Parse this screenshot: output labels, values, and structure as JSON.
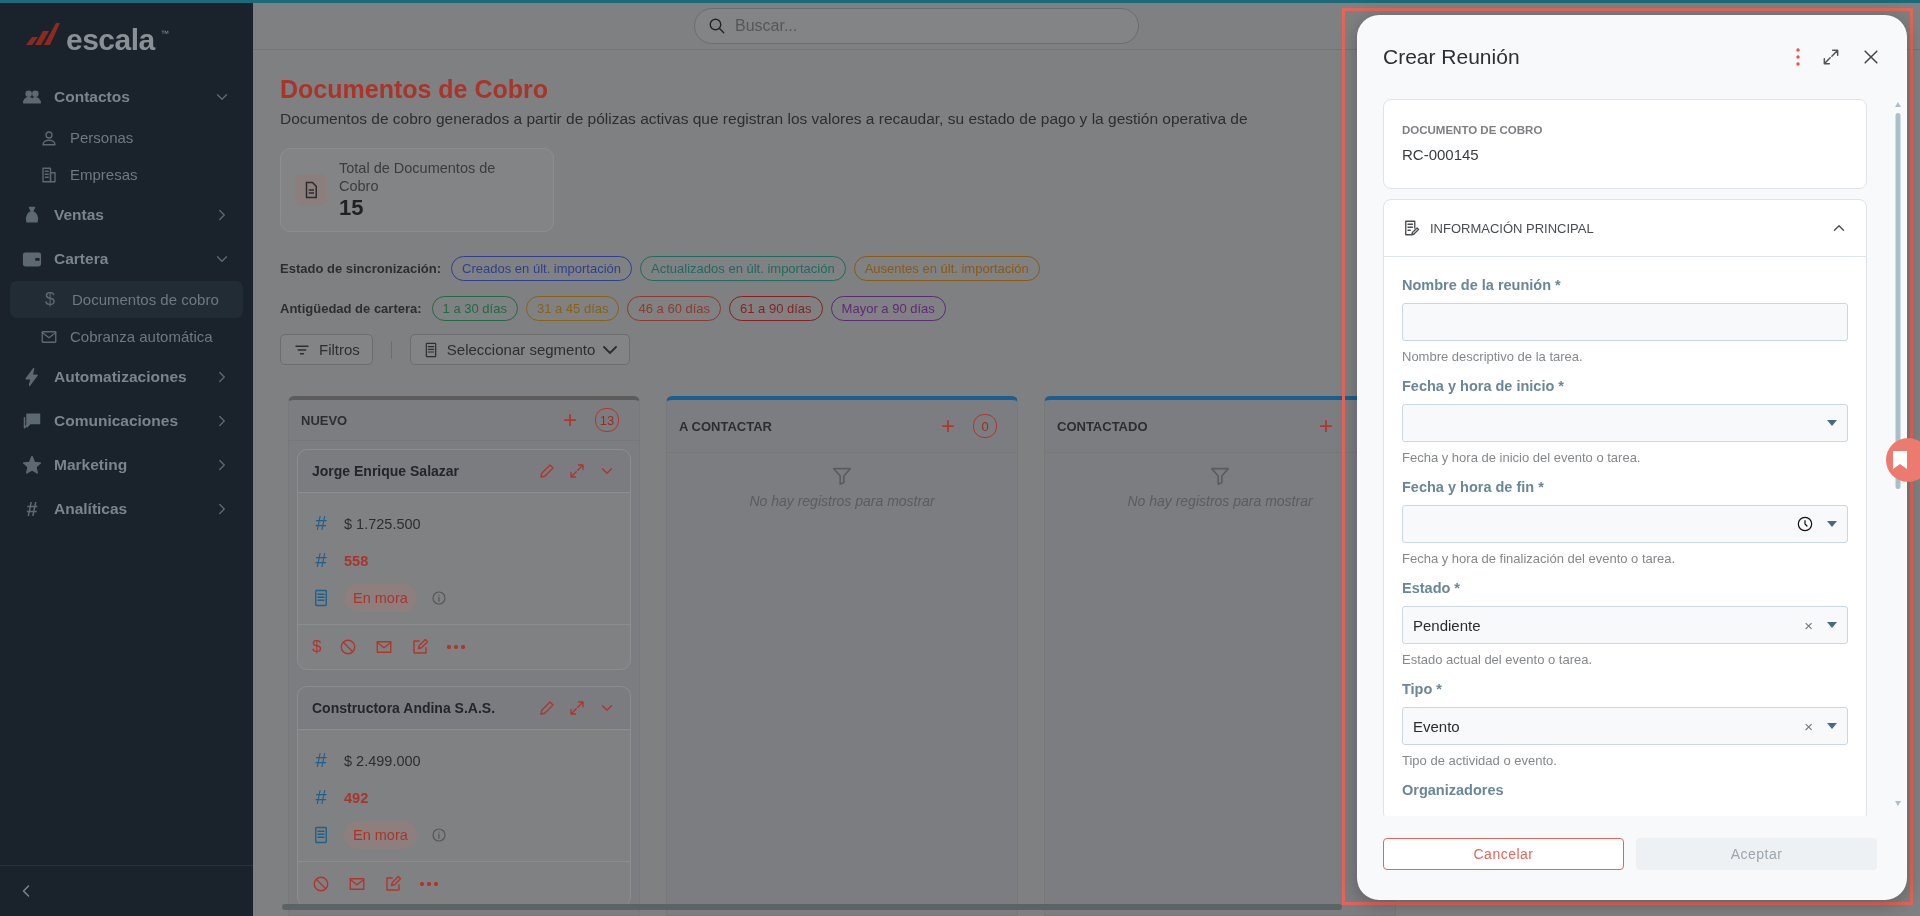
{
  "sidebar": {
    "logo": "escala",
    "trademark": "™",
    "items": [
      {
        "label": "Contactos",
        "expanded": true,
        "children": [
          {
            "label": "Personas",
            "selected": false
          },
          {
            "label": "Empresas",
            "selected": false
          }
        ]
      },
      {
        "label": "Ventas",
        "expanded": false
      },
      {
        "label": "Cartera",
        "expanded": true,
        "children": [
          {
            "label": "Documentos de cobro",
            "glyph": "$",
            "selected": true
          },
          {
            "label": "Cobranza automática",
            "selected": false
          }
        ]
      },
      {
        "label": "Automatizaciones",
        "expanded": false
      },
      {
        "label": "Comunicaciones",
        "expanded": false
      },
      {
        "label": "Marketing",
        "expanded": false
      },
      {
        "label": "Analíticas",
        "glyph": "#",
        "expanded": false
      }
    ]
  },
  "search": {
    "placeholder": "Buscar..."
  },
  "page": {
    "title": "Documentos de Cobro",
    "description": "Documentos de cobro generados a partir de pólizas activas que registran los valores a recaudar, su estado de pago y la gestión operativa de"
  },
  "stat": {
    "label": "Total de Documentos de Cobro",
    "value": "15"
  },
  "sync_filter": {
    "label": "Estado de sincronización:",
    "chips": [
      {
        "label": "Creados en últ. importación",
        "color": "#2f3f8f"
      },
      {
        "label": "Actualizados en últ. importación",
        "color": "#1f6b5f"
      },
      {
        "label": "Ausentes en últ. importación",
        "color": "#8a5a12"
      }
    ]
  },
  "age_filter": {
    "label": "Antigüedad de cartera:",
    "chips": [
      {
        "label": "1 a 30 días",
        "color": "#1f6b45"
      },
      {
        "label": "31 a 45 días",
        "color": "#8a6212"
      },
      {
        "label": "46 a 60 días",
        "color": "#8f3a2a"
      },
      {
        "label": "61 a 90 días",
        "color": "#8a1f1f"
      },
      {
        "label": "Mayor a 90 días",
        "color": "#5e2a78"
      }
    ]
  },
  "toolbar": {
    "filters_button": "Filtros",
    "segment_select": "Seleccionar segmento"
  },
  "columns": [
    {
      "title": "NUEVO",
      "add": "+",
      "count": "13",
      "color": "#5c5c5c",
      "cards": [
        {
          "name": "Jorge Enrique Salazar",
          "rows": [
            {
              "kind": "amount",
              "glyph": "#",
              "text": "$ 1.725.500"
            },
            {
              "kind": "days",
              "glyph": "#",
              "text": "558"
            },
            {
              "kind": "status",
              "text": "En mora"
            }
          ],
          "actions": [
            "$"
          ]
        },
        {
          "name": "Constructora Andina S.A.S.",
          "rows": [
            {
              "kind": "amount",
              "glyph": "#",
              "text": "$ 2.499.000"
            },
            {
              "kind": "days",
              "glyph": "#",
              "text": "492"
            },
            {
              "kind": "status",
              "text": "En mora"
            }
          ]
        }
      ]
    },
    {
      "title": "A CONTACTAR",
      "add": "+",
      "count": "0",
      "color": "#1a5f91",
      "empty": "No hay registros para mostrar"
    },
    {
      "title": "CONTACTADO",
      "add": "+",
      "color": "#1a5f91",
      "empty": "No hay registros para mostrar"
    }
  ],
  "modal": {
    "title": "Crear Reunión",
    "document": {
      "label": "DOCUMENTO DE COBRO",
      "value": "RC-000145"
    },
    "section": {
      "title": "INFORMACIÓN PRINCIPAL",
      "expanded": true,
      "fields": [
        {
          "kind": "text",
          "label": "Nombre de la reunión *",
          "help": "Nombre descriptivo de la tarea."
        },
        {
          "kind": "date",
          "label": "Fecha y hora de inicio *",
          "help": "Fecha y hora de inicio del evento o tarea."
        },
        {
          "kind": "datetime",
          "label": "Fecha y hora de fin *",
          "help": "Fecha y hora de finalización del evento o tarea."
        },
        {
          "kind": "select",
          "label": "Estado *",
          "value": "Pendiente",
          "clear": "×",
          "help": "Estado actual del evento o tarea."
        },
        {
          "kind": "select",
          "label": "Tipo *",
          "value": "Evento",
          "clear": "×",
          "help": "Tipo de actividad o evento."
        },
        {
          "kind": "label",
          "label": "Organizadores"
        }
      ]
    },
    "cancel": {
      "label": "Cancelar"
    },
    "accept": {
      "label": "Aceptar",
      "disabled": true
    }
  }
}
